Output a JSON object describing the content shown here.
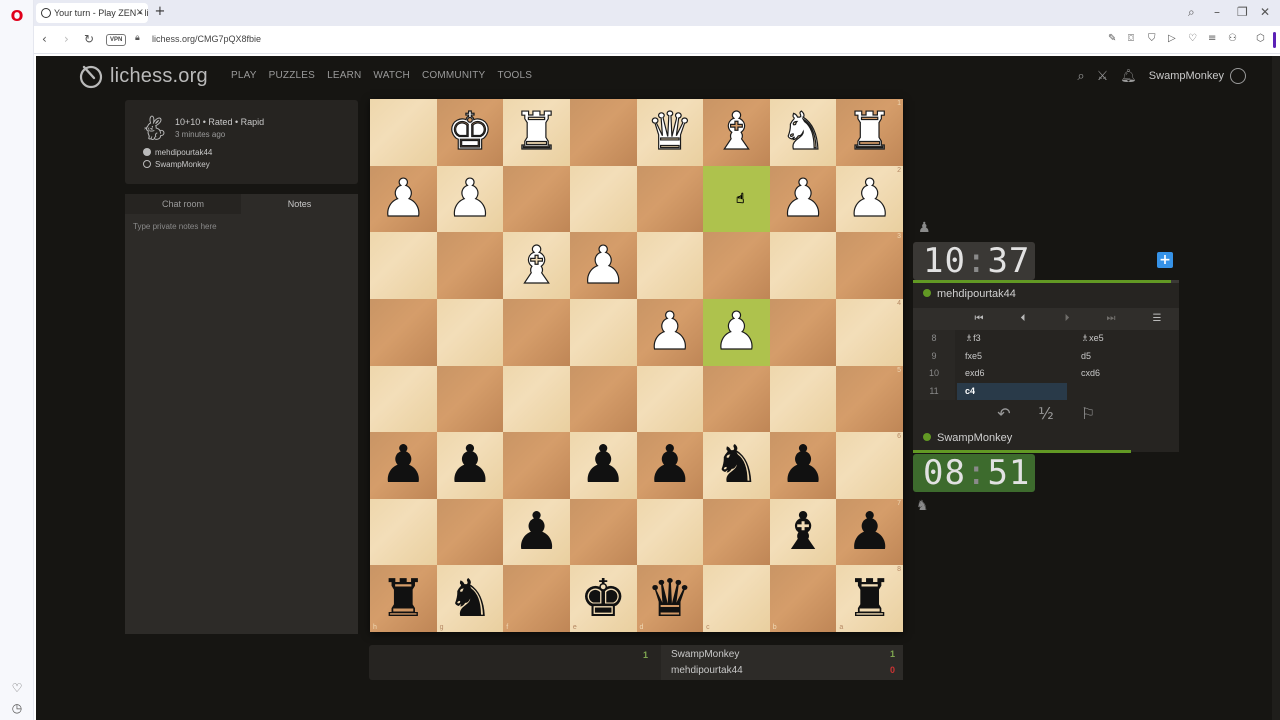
{
  "browser": {
    "tab_title": "Your turn - Play ZEN • lich",
    "url": "lichess.org/CMG7pQX8fbie",
    "vpn_label": "VPN"
  },
  "site": {
    "logo_text": "lichess.org",
    "nav": [
      "PLAY",
      "PUZZLES",
      "LEARN",
      "WATCH",
      "COMMUNITY",
      "TOOLS"
    ],
    "username": "SwampMonkey"
  },
  "game_meta": {
    "setup": "10+10 • Rated • Rapid",
    "time_ago": "3 minutes ago",
    "white_player": "mehdipourtak44",
    "black_player": "SwampMonkey"
  },
  "chat": {
    "tabs": [
      "Chat room",
      "Notes"
    ],
    "active_tab": "Notes",
    "notes_placeholder": "Type private notes here"
  },
  "board": {
    "orientation": "black",
    "rank_labels": [
      "1",
      "2",
      "3",
      "4",
      "5",
      "6",
      "7",
      "8"
    ],
    "file_labels": [
      "h",
      "g",
      "f",
      "e",
      "d",
      "c",
      "b",
      "a"
    ],
    "highlight_squares": [
      [
        1,
        5
      ],
      [
        3,
        5
      ]
    ],
    "rows": [
      [
        "",
        "wK",
        "wR",
        "",
        "wQ",
        "wB",
        "wN",
        "wR"
      ],
      [
        "wP",
        "wP",
        "",
        "",
        "",
        "",
        "wP",
        "wP"
      ],
      [
        "",
        "",
        "wB",
        "wP",
        "",
        "",
        "",
        ""
      ],
      [
        "",
        "",
        "",
        "",
        "wP",
        "wP",
        "",
        ""
      ],
      [
        "",
        "",
        "",
        "",
        "",
        "",
        "",
        ""
      ],
      [
        "bP",
        "bP",
        "",
        "bP",
        "bP",
        "bN",
        "bP",
        ""
      ],
      [
        "",
        "",
        "bP",
        "",
        "",
        "",
        "bB",
        "bP"
      ],
      [
        "bR",
        "bN",
        "",
        "bK",
        "bQ",
        "",
        "",
        "bR"
      ]
    ]
  },
  "crosstable": {
    "score_left": "1",
    "rows": [
      {
        "name": "SwampMonkey",
        "result": "1",
        "color": "#7fa650"
      },
      {
        "name": "mehdipourtak44",
        "result": "0",
        "color": "#cc3333"
      }
    ]
  },
  "clocks": {
    "opponent": {
      "min": "10",
      "sec": "37"
    },
    "self": {
      "min": "08",
      "sec": "51"
    }
  },
  "players": {
    "opponent": "mehdipourtak44",
    "self": "SwampMonkey"
  },
  "moves": [
    {
      "num": "8",
      "white": "♗f3",
      "black": "♗xe5"
    },
    {
      "num": "9",
      "white": "fxe5",
      "black": "d5"
    },
    {
      "num": "10",
      "white": "exd6",
      "black": "cxd6"
    },
    {
      "num": "11",
      "white": "c4",
      "black": ""
    }
  ],
  "icons": {
    "move_nav": [
      "first-move-icon",
      "prev-move-icon",
      "next-move-icon",
      "last-move-icon",
      "menu-icon"
    ],
    "actions": [
      "takeback-icon",
      "draw-offer-icon",
      "resign-flag-icon"
    ]
  },
  "colors": {
    "accent_green": "#629924",
    "move_highlight": "#aec24d",
    "plus_blue": "#3692e7"
  }
}
